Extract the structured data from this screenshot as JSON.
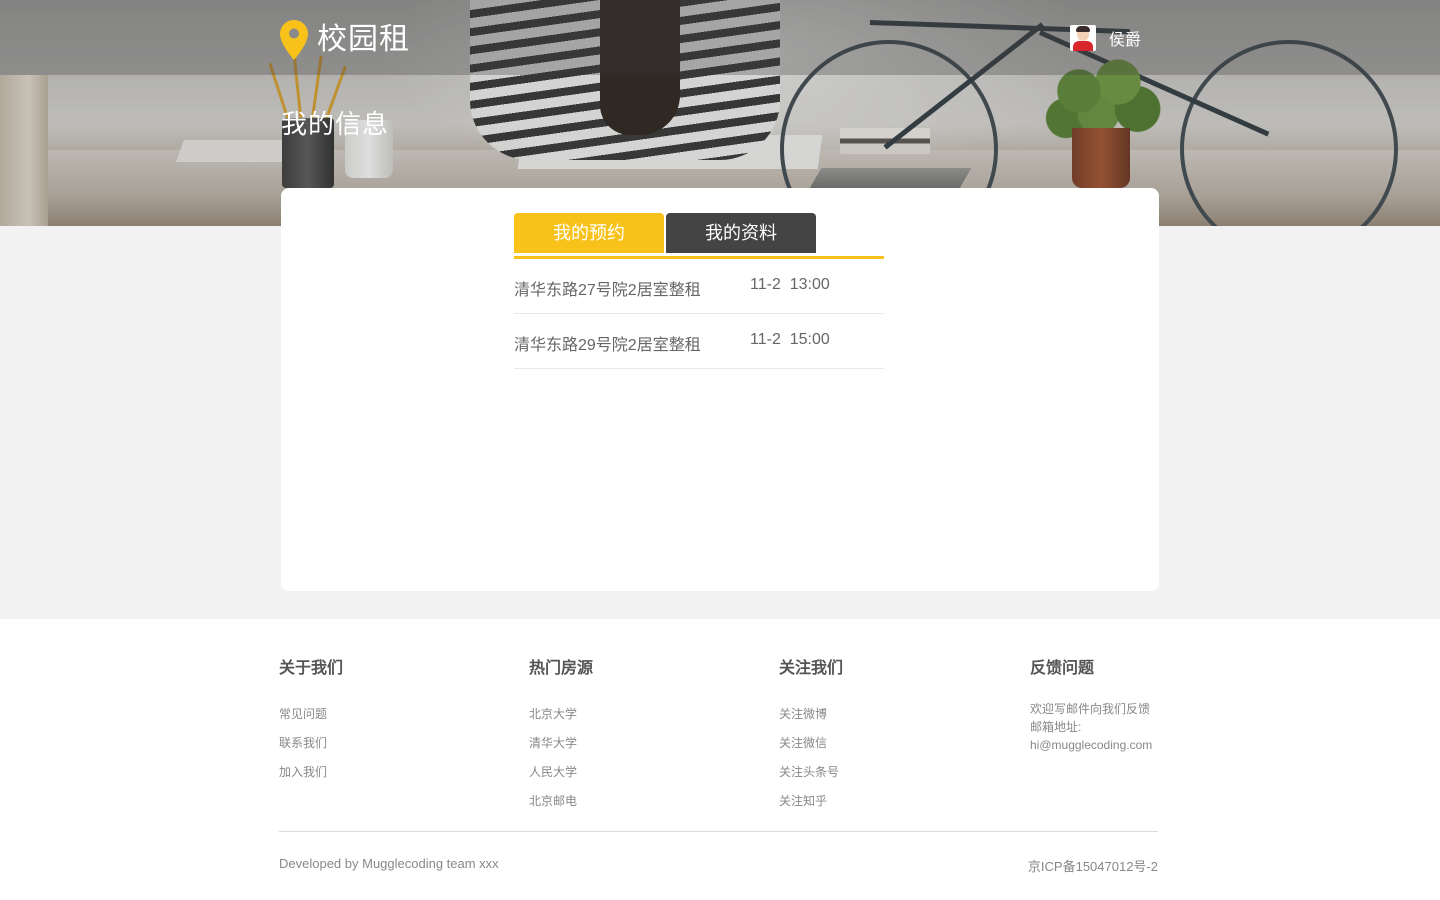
{
  "header": {
    "brand": "校园租",
    "username": "侯爵",
    "page_title": "我的信息",
    "accent_color": "#f8c21b"
  },
  "tabs": [
    {
      "label": "我的预约",
      "active": true
    },
    {
      "label": "我的资料",
      "active": false
    }
  ],
  "reservations": [
    {
      "name": "清华东路27号院2居室整租",
      "time": "11-2  13:00"
    },
    {
      "name": "清华东路29号院2居室整租",
      "time": "11-2  15:00"
    }
  ],
  "footer": {
    "columns": [
      {
        "title": "关于我们",
        "links": [
          "常见问题",
          "联系我们",
          "加入我们"
        ]
      },
      {
        "title": "热门房源",
        "links": [
          "北京大学",
          "清华大学",
          "人民大学",
          "北京邮电"
        ]
      },
      {
        "title": "关注我们",
        "links": [
          "关注微博",
          "关注微信",
          "关注头条号",
          "关注知乎"
        ]
      }
    ],
    "feedback": {
      "title": "反馈问题",
      "line1": "欢迎写邮件向我们反馈",
      "line2": "邮箱地址:",
      "email": "hi@mugglecoding.com"
    },
    "credit": "Developed by Mugglecoding team xxx",
    "icp": "京ICP备15047012号-2"
  },
  "icons": {
    "logo": "location-pin-icon",
    "user": "avatar"
  }
}
